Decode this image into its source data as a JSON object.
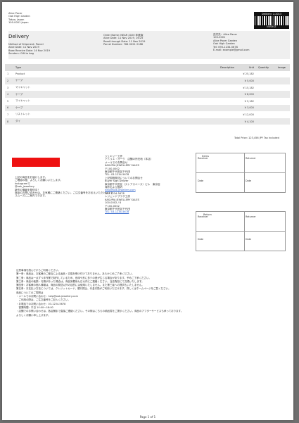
{
  "seller": {
    "address_lines": [
      "Alice Pacer",
      "Oak High Garden",
      "Tokyo, Japan",
      "100-0001 Japan"
    ]
  },
  "barcode": {
    "label": "Delivery: 2-2013",
    "number": "INVOICE"
  },
  "document": {
    "title": "Delivery"
  },
  "customer": {
    "lines": [
      "Method of Shipment: Parcel",
      "Alice Date: 11 Nov 2019",
      "Base Receive Date: 14 Nov 2019",
      "Senders: Gift to bag"
    ]
  },
  "order": {
    "lines": [
      "Order Name: NEAR 2020 年度版",
      "Alice Date: 11 Nov 2019, 16:25",
      "Read through Date: 11 Nov 2019",
      "Parcel Number: 784 0021 2188"
    ]
  },
  "ship_to": {
    "lines": [
      "送付先：Alice Pacer",
      "100-0001",
      "Alice Pacer Garden",
      "Oak High Garden",
      "Tel: 090-1234-5678",
      "E-mail: example@gmail.com"
    ]
  },
  "items_table": {
    "headers": [
      "Type",
      "Description",
      "Unit",
      "Quantity",
      "Image"
    ],
    "rows": [
      {
        "n": "1",
        "type": "Product",
        "amount": "¥ 25,182"
      },
      {
        "n": "2",
        "type": "ケープ",
        "amount": "¥ 5,000"
      },
      {
        "n": "3",
        "type": "マイキャット",
        "amount": "¥ 15,182"
      },
      {
        "n": "4",
        "type": "ケープ",
        "amount": "¥ 8,000"
      },
      {
        "n": "5",
        "type": "マイキャット",
        "amount": "¥ 5,182"
      },
      {
        "n": "6",
        "type": "ケープ",
        "amount": "¥ 3,000"
      },
      {
        "n": "7",
        "type": "リストレット",
        "amount": "¥ 12,000"
      },
      {
        "n": "8",
        "type": "ダイ",
        "amount": "¥ 4,100"
      }
    ]
  },
  "total": "Total Price: 123,456 JPY Tax included",
  "notes": {
    "lines": [
      "上記の商品をお届けします。",
      "ご確認の程、よろしくお願いいたします。",
      "Instagramで",
      "@oak_jewellery",
      "新作の情報を発信中！",
      "商品のお問い合わせは、お気軽にご連絡ください。ご注文番号をお伝えいただけますと",
      "スムーズにご案内できます。"
    ]
  },
  "contact": {
    "lines": [
      "ジュエリー工房",
      "アトリエ・オーク　店舗の所在地（本店）",
      "メールでのお問合せ",
      "KASUPIA JEWELLERY SALES",
      "〒100-0002",
      "東京都千代田区千代田",
      "TEL: 03-1234-5678",
      "上記国際発送についてのお問合せ",
      "Buyer Sign Deliver",
      "東京都千代田区（ストアスペース）ビル　東京店",
      "海外および国内",
      "help@oak-jewellery.com",
      "080-1234-5678",
      "レジェンドプラザ工房",
      "KASUPIA JEWELLERY SALES",
      "100-0002 / 8",
      "〒100-0002",
      "東京都千代田区千代田",
      "TEL: 03-1234-5678"
    ],
    "link_indices": [
      11,
      18
    ]
  },
  "box_top": {
    "title": "Items",
    "labels": [
      "Receiver",
      "Returner",
      "Date",
      "Date"
    ]
  },
  "box_bottom": {
    "title": "Return",
    "labels": [
      "Receiver",
      "Returner",
      "Date",
      "Date"
    ]
  },
  "terms": {
    "lines": [
      "注意事項を読んでからご利用ください。",
      "第一条：商品は、お客様のご都合による返品・交換を受け付けておりません。あらかじめご了承ください。",
      "第二条：商品は一点ずつ手作業で制作しているため、色味や形に多少の差が生じる場合があります。予めご了承ください。",
      "第三条：商品の破損・汚損があった場合は、商品到着後七日以内にご連絡ください。当店負担にて交換いたします。",
      "第四条：お客様の個人情報は、商品の発送以外の目的には使用いたしません。また第三者への提供もいたしません。",
      "第五条：お支払い方法については、クレジットカード、銀行振込、代金引換がご利用いただけます。詳しくはホームページをご覧ください。",
      "商品についてのご質問は",
      "・メールでのお問い合わせ：help@oak-jewellery.com",
      "　ご利用の際は、ご注文番号をご記入ください。",
      "・お電話でのお問い合わせ：03-1234-5678",
      "　営業時間：平日 10:00〜18:00",
      "・店舗でのお問い合わせは、各店舗まで直接ご連絡ください。その際はこちらの納品書をご提示ください。商品のアフターサービスも承っております。",
      "よろしくお願い申し上げます。"
    ]
  },
  "footer": "Page 1 of 1",
  "colors": {
    "accent_red": "#ee1111",
    "header_band": "#efefef",
    "link": "#3366cc"
  }
}
